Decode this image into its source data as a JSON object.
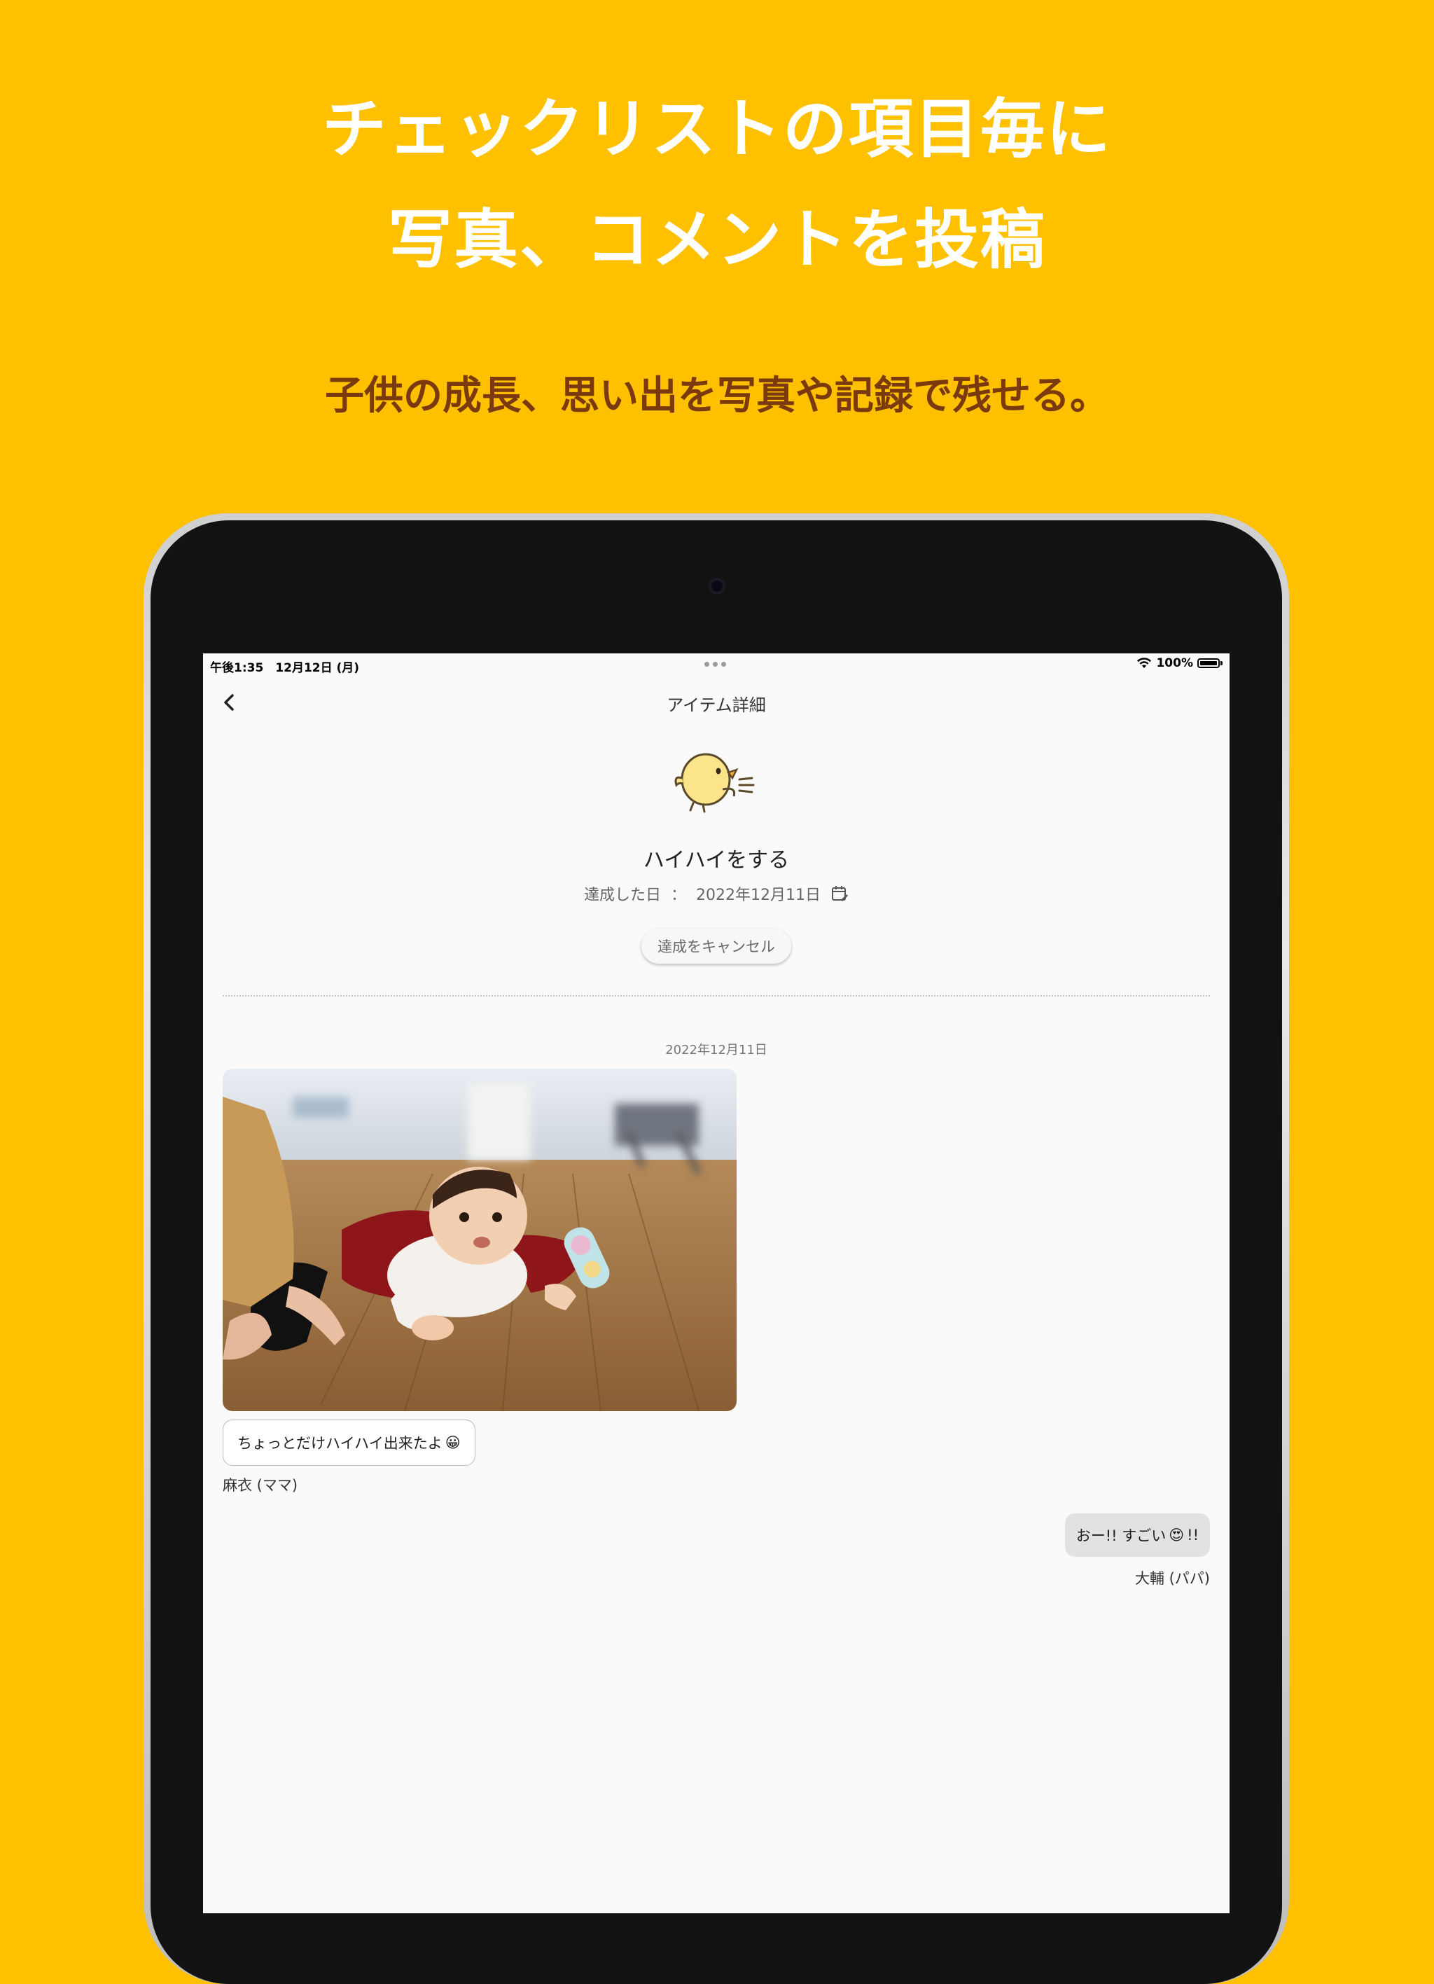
{
  "promo": {
    "headline_line1": "チェックリストの項目毎に",
    "headline_line2": "写真、コメントを投稿",
    "subheadline": "子供の成長、思い出を写真や記録で残せる。"
  },
  "status_bar": {
    "time_date": "午後1:35　12月12日 (月)",
    "battery": "100%"
  },
  "nav": {
    "title": "アイテム詳細",
    "back_icon": "chevron-left-icon"
  },
  "item": {
    "icon": "chick-icon",
    "title": "ハイハイをする",
    "achieved_label": "達成した日",
    "separator": "：",
    "achieved_date": "2022年12月11日",
    "calendar_icon": "calendar-edit-icon",
    "cancel_button": "達成をキャンセル"
  },
  "timeline": {
    "date": "2022年12月11日",
    "posts": [
      {
        "text": "ちょっとだけハイハイ出来たよ",
        "emoji": "😀",
        "author": "麻衣 (ママ)"
      },
      {
        "text_before": "おー!! すごい",
        "emoji": "😍",
        "text_after": "!!",
        "author": "大輔 (パパ)"
      }
    ]
  },
  "colors": {
    "background": "#FFC000",
    "headline": "#FFFFFF",
    "subheadline": "#7A3A0E",
    "screen": "#FAFAFA"
  }
}
